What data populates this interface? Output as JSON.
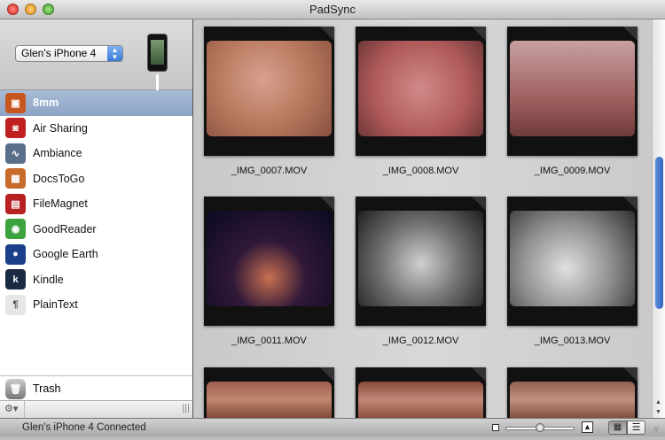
{
  "window": {
    "title": "PadSync"
  },
  "device": {
    "selected": "Glen's iPhone 4"
  },
  "apps": [
    {
      "label": "8mm",
      "icon": "8mm-icon",
      "color": "#c8561f",
      "glyph": "▣"
    },
    {
      "label": "Air Sharing",
      "icon": "air-sharing-icon",
      "color": "#c02020",
      "glyph": "◙"
    },
    {
      "label": "Ambiance",
      "icon": "ambiance-icon",
      "color": "#5a6f8a",
      "glyph": "∿"
    },
    {
      "label": "DocsToGo",
      "icon": "docstogo-icon",
      "color": "#c76a2a",
      "glyph": "▦"
    },
    {
      "label": "FileMagnet",
      "icon": "filemagnet-icon",
      "color": "#b82222",
      "glyph": "▤"
    },
    {
      "label": "GoodReader",
      "icon": "goodreader-icon",
      "color": "#3ea33e",
      "glyph": "◉"
    },
    {
      "label": "Google Earth",
      "icon": "google-earth-icon",
      "color": "#1c3f8a",
      "glyph": "●"
    },
    {
      "label": "Kindle",
      "icon": "kindle-icon",
      "color": "#1a2a44",
      "glyph": "k"
    },
    {
      "label": "PlainText",
      "icon": "plaintext-icon",
      "color": "#e6e6e6",
      "glyph": "¶"
    }
  ],
  "trash": {
    "label": "Trash"
  },
  "files": [
    {
      "name": "_IMG_0007.MOV",
      "bg": "radial-gradient(circle at 45% 40%,#d9a090,#b87a5e 50%,#8a5040)"
    },
    {
      "name": "_IMG_0008.MOV",
      "bg": "radial-gradient(circle at 50% 50%,#d08a88,#b05a5a 60%,#703838)"
    },
    {
      "name": "_IMG_0009.MOV",
      "bg": "linear-gradient(#c8a0a0,#a06060 60%,#703a3a)"
    },
    {
      "name": "_IMG_0011.MOV",
      "bg": "radial-gradient(circle at 50% 70%,#c87050,#301838 40%,#0a0a20)"
    },
    {
      "name": "_IMG_0012.MOV",
      "bg": "radial-gradient(circle at 50% 55%,#d0d0d0,#707070 50%,#202020)"
    },
    {
      "name": "_IMG_0013.MOV",
      "bg": "radial-gradient(circle at 45% 60%,#e0e0e0,#909090 50%,#303030)"
    },
    {
      "name": "",
      "bg": "linear-gradient(#a06050,#c08870 50%,#804838)"
    },
    {
      "name": "",
      "bg": "linear-gradient(#8a4a3a,#c08878 50%,#905040)"
    },
    {
      "name": "",
      "bg": "linear-gradient(#906050,#c09080 50%,#805040)"
    }
  ],
  "status": {
    "text": "Glen's iPhone 4 Connected"
  }
}
